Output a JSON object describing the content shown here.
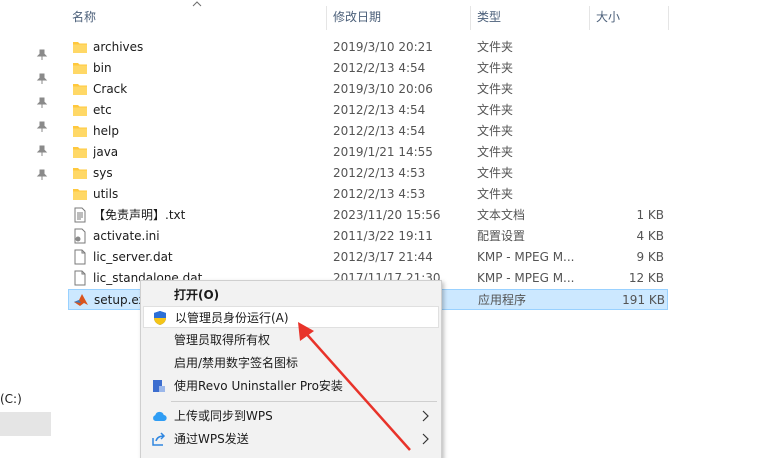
{
  "header": {
    "name": "名称",
    "date": "修改日期",
    "type": "类型",
    "size": "大小"
  },
  "nav": {
    "drive_label": "(C:)"
  },
  "files": [
    {
      "name": "archives",
      "date": "2019/3/10 20:21",
      "type": "文件夹",
      "size": "",
      "icon": "folder-icon"
    },
    {
      "name": "bin",
      "date": "2012/2/13 4:54",
      "type": "文件夹",
      "size": "",
      "icon": "folder-icon"
    },
    {
      "name": "Crack",
      "date": "2019/3/10 20:06",
      "type": "文件夹",
      "size": "",
      "icon": "folder-icon"
    },
    {
      "name": "etc",
      "date": "2012/2/13 4:54",
      "type": "文件夹",
      "size": "",
      "icon": "folder-icon"
    },
    {
      "name": "help",
      "date": "2012/2/13 4:54",
      "type": "文件夹",
      "size": "",
      "icon": "folder-icon"
    },
    {
      "name": "java",
      "date": "2019/1/21 14:55",
      "type": "文件夹",
      "size": "",
      "icon": "folder-icon"
    },
    {
      "name": "sys",
      "date": "2012/2/13 4:53",
      "type": "文件夹",
      "size": "",
      "icon": "folder-icon"
    },
    {
      "name": "utils",
      "date": "2012/2/13 4:53",
      "type": "文件夹",
      "size": "",
      "icon": "folder-icon"
    },
    {
      "name": "【免责声明】.txt",
      "date": "2023/11/20 15:56",
      "type": "文本文档",
      "size": "1 KB",
      "icon": "text-file-icon"
    },
    {
      "name": "activate.ini",
      "date": "2011/3/22 19:11",
      "type": "配置设置",
      "size": "4 KB",
      "icon": "ini-file-icon"
    },
    {
      "name": "lic_server.dat",
      "date": "2012/3/17 21:44",
      "type": "KMP - MPEG M...",
      "size": "9 KB",
      "icon": "file-icon"
    },
    {
      "name": "lic_standalone.dat",
      "date": "2017/11/17 21:30",
      "type": "KMP - MPEG M...",
      "size": "12 KB",
      "icon": "file-icon"
    },
    {
      "name": "setup.exe",
      "date": "",
      "type": "应用程序",
      "size": "191 KB",
      "icon": "matlab-icon"
    }
  ],
  "menu": {
    "open": "打开(O)",
    "run_as_admin": "以管理员身份运行(A)",
    "take_ownership": "管理员取得所有权",
    "toggle_signature": "启用/禁用数字签名图标",
    "revo_uninstall": "使用Revo Uninstaller Pro安装",
    "wps_sync": "上传或同步到WPS",
    "wps_send": "通过WPS发送"
  },
  "colors": {
    "selection": "#cce8ff",
    "folder": "#ffc83d",
    "arrow": "#e8332a"
  }
}
